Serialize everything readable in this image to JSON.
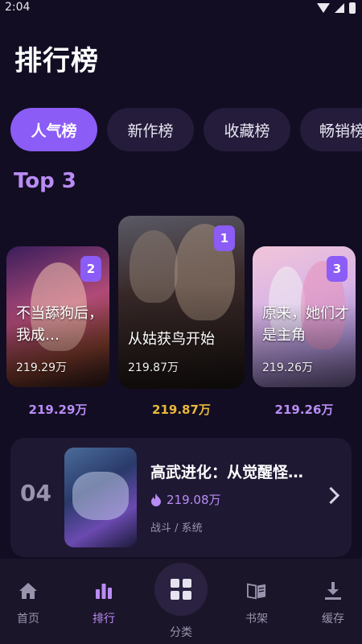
{
  "status_bar": {
    "time": "2:04"
  },
  "header": {
    "title": "排行榜"
  },
  "tabs": [
    {
      "label": "人气榜",
      "active": true
    },
    {
      "label": "新作榜",
      "active": false
    },
    {
      "label": "收藏榜",
      "active": false
    },
    {
      "label": "畅销榜",
      "active": false
    }
  ],
  "top3": {
    "section_title": "Top 3",
    "items": [
      {
        "rank": "2",
        "title": "不当舔狗后，我成…",
        "count": "219.29万",
        "count_below": "219.29万"
      },
      {
        "rank": "1",
        "title": "从姑获鸟开始",
        "count": "219.87万",
        "count_below": "219.87万"
      },
      {
        "rank": "3",
        "title": "原来，她们才是主角",
        "count": "219.26万",
        "count_below": "219.26万"
      }
    ]
  },
  "list": [
    {
      "rank": "04",
      "title": "高武进化：从觉醒怪…",
      "count": "219.08万",
      "tags": "战斗 / 系统"
    }
  ],
  "bottom_nav": [
    {
      "label": "首页",
      "icon": "home-icon",
      "active": false
    },
    {
      "label": "排行",
      "icon": "bar-chart-icon",
      "active": true
    },
    {
      "label": "分类",
      "icon": "grid-icon",
      "active": false
    },
    {
      "label": "书架",
      "icon": "book-icon",
      "active": false
    },
    {
      "label": "缓存",
      "icon": "download-icon",
      "active": false
    }
  ],
  "colors": {
    "accent": "#8b5cf6",
    "background": "#120d22",
    "gold": "#e8b83a"
  }
}
